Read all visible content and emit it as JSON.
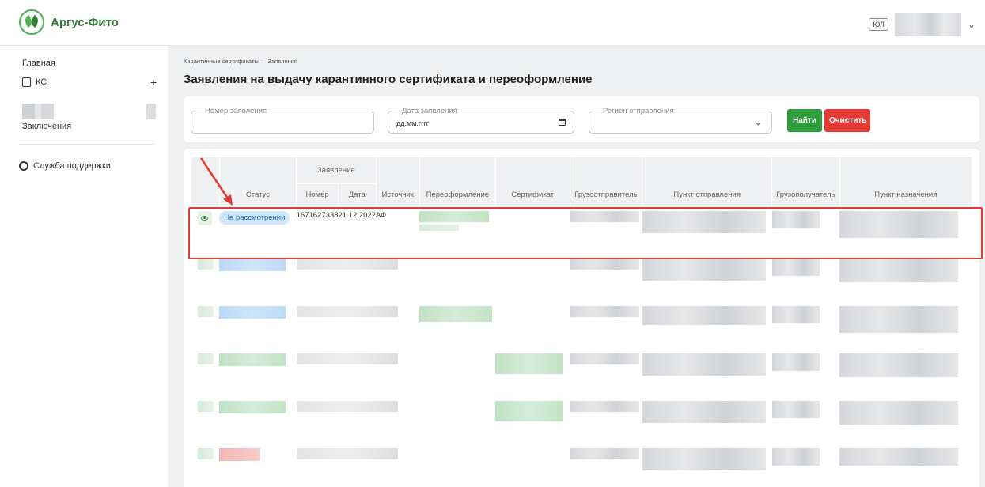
{
  "app": {
    "name": "Аргус-Фито",
    "user_tag": "ЮЛ"
  },
  "sidebar": {
    "items": [
      {
        "label": "Главная"
      },
      {
        "label": "КС"
      },
      {
        "label": "Заключения"
      },
      {
        "label": "Служба поддержки"
      }
    ],
    "add_symbol": "+"
  },
  "breadcrumb": {
    "text": "Карантинные сертификаты — Заявления"
  },
  "page": {
    "title": "Заявления на выдачу карантинного сертификата и переоформление"
  },
  "filters": {
    "number": {
      "label": "Номер заявления",
      "value": ""
    },
    "date": {
      "label": "Дата заявления",
      "value": "дд.мм.гггг"
    },
    "region": {
      "label": "Регион отправления",
      "value": ""
    },
    "find_label": "Найти",
    "clear_label": "Очистить"
  },
  "table": {
    "group_header": "Заявление",
    "columns": {
      "status": "Статус",
      "number": "Номер",
      "date": "Дата",
      "source": "Источник",
      "reissue": "Переоформление",
      "certificate": "Сертификат",
      "shipper": "Грузоотправитель",
      "departure": "Пункт отправления",
      "consignee": "Грузополучатель",
      "destination": "Пункт назначения"
    },
    "first_row": {
      "status": "На рассмотрении",
      "number": "1671627338",
      "date": "21.12.2022",
      "source": "АФ"
    }
  },
  "colors": {
    "brand": "#2e7d32",
    "find_button": "#2e9e3c",
    "clear_button": "#e53935",
    "status_pill_bg": "#cfe6fb",
    "highlight": "#e53935"
  },
  "icons": [
    "logo-icon",
    "document-icon",
    "plus-icon",
    "support-icon",
    "eye-icon",
    "calendar-icon",
    "chevron-down-icon"
  ]
}
